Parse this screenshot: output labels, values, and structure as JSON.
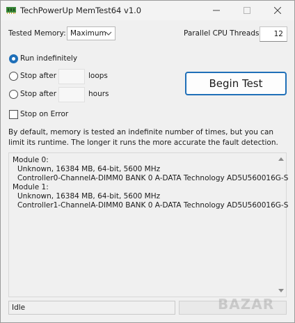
{
  "window": {
    "title": "TechPowerUp MemTest64 v1.0"
  },
  "colors": {
    "accent": "#1f6fb8",
    "progress": "#2e9e3c"
  },
  "icons": {
    "app": "memory-chip-icon",
    "minimize": "minimize-icon",
    "maximize": "maximize-icon",
    "close": "close-icon"
  },
  "config": {
    "tested_memory_label": "Tested Memory:",
    "tested_memory_value": "Maximum",
    "threads_label": "Parallel CPU Threads:",
    "threads_value": "12"
  },
  "options": {
    "run_indefinitely": "Run indefinitely",
    "stop_after": "Stop after",
    "loops_label": "loops",
    "hours_label": "hours",
    "stop_on_error": "Stop on Error",
    "selected": "run_indefinitely"
  },
  "begin_button": "Begin Test",
  "description": "By default, memory is tested an indefinite number of times, but you can limit its runtime. The longer it runs the more accurate the fault detection.",
  "modules": [
    {
      "title": "Module 0:",
      "line1": "Unknown, 16384 MB, 64-bit, 5600 MHz",
      "line2": "Controller0-ChannelA-DIMM0 BANK 0 A-DATA Technology AD5U560016G-S"
    },
    {
      "title": "Module 1:",
      "line1": "Unknown, 16384 MB, 64-bit, 5600 MHz",
      "line2": "Controller1-ChannelA-DIMM0 BANK 0 A-DATA Technology AD5U560016G-S"
    }
  ],
  "status": {
    "text": "Idle",
    "progress": 0
  },
  "watermark": "BAZAR"
}
